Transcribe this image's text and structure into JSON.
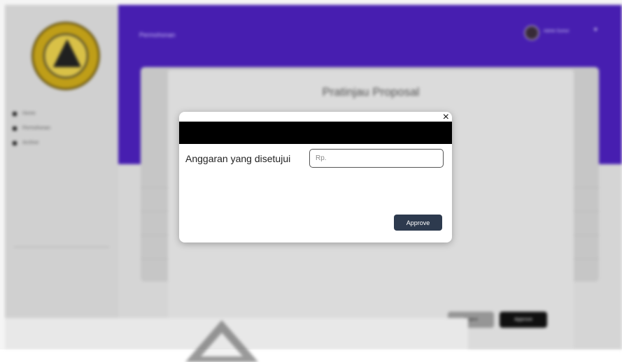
{
  "app": {
    "page_title": "Permohonan",
    "user_name": "Admin Sumut"
  },
  "sidebar": {
    "items": [
      {
        "label": "Home",
        "icon": "home-icon"
      },
      {
        "label": "Permohonan",
        "icon": "document-icon"
      },
      {
        "label": "Archive",
        "icon": "archive-icon"
      }
    ]
  },
  "preview": {
    "title": "Pratinjau Proposal",
    "reject_label": "Reject",
    "approve_label": "Approve"
  },
  "modal": {
    "close_glyph": "×",
    "field_label": "Anggaran yang disetujui",
    "input_value": "",
    "input_placeholder": "Rp.",
    "approve_label": "Approve"
  },
  "colors": {
    "header": "#4a20b8",
    "approve_button": "#2d3a4e",
    "banner": "#000000"
  }
}
